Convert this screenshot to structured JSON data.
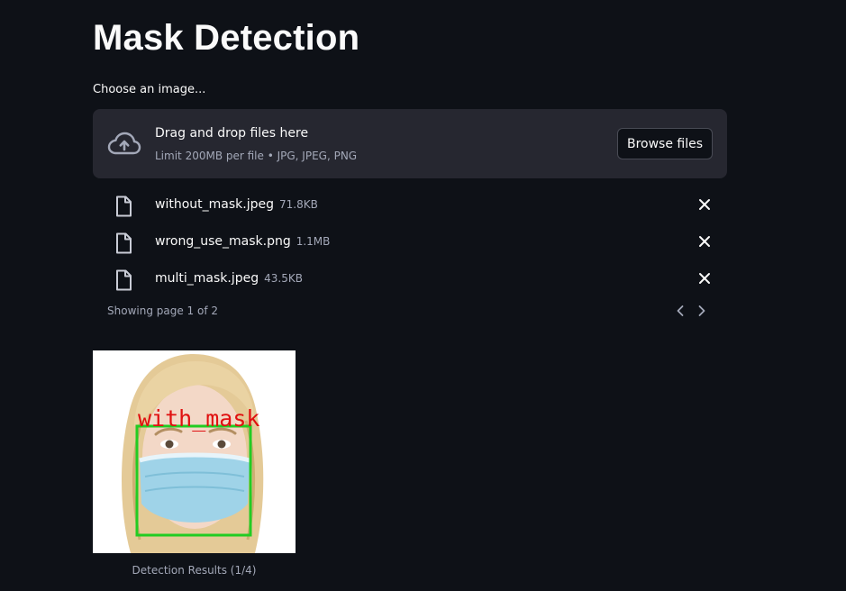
{
  "page": {
    "title": "Mask Detection"
  },
  "uploader": {
    "label": "Choose an image...",
    "drop_text": "Drag and drop files here",
    "limit_text": "Limit 200MB per file • JPG, JPEG, PNG",
    "browse_label": "Browse files",
    "icon": "cloud-upload-icon"
  },
  "files": [
    {
      "name": "without_mask.jpeg",
      "size": "71.8KB"
    },
    {
      "name": "wrong_use_mask.png",
      "size": "1.1MB"
    },
    {
      "name": "multi_mask.jpeg",
      "size": "43.5KB"
    }
  ],
  "pagination": {
    "text": "Showing page 1 of 2"
  },
  "result": {
    "label": "with_mask",
    "caption": "Detection Results (1/4)"
  },
  "colors": {
    "background": "#0e1117",
    "panel": "#262730",
    "muted_text": "#a3a8b8",
    "detection_box": "#22cc22",
    "detection_label": "#e01010"
  }
}
